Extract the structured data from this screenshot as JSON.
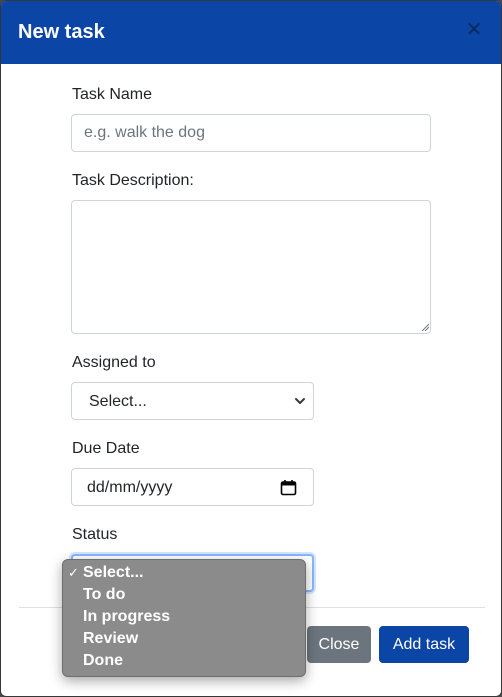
{
  "modal": {
    "title": "New task",
    "close_icon": "close-icon",
    "header_color": "#0b45a6"
  },
  "form": {
    "task_name_label": "Task Name",
    "task_name_placeholder": "e.g. walk the dog",
    "task_name_value": "",
    "description_label": "Task Description:",
    "description_value": "",
    "assigned_label": "Assigned to",
    "assigned_value": "Select...",
    "due_date_label": "Due Date",
    "due_date_value": "dd/mm/yyyy",
    "status_label": "Status",
    "status_value": "Select..."
  },
  "status_dropdown": {
    "options": [
      "Select...",
      "To do",
      "In progress",
      "Review",
      "Done"
    ],
    "selected_index": 0
  },
  "footer": {
    "close_label": "Close",
    "add_label": "Add task",
    "close_color": "#6c757d",
    "add_color": "#0b45a6"
  }
}
